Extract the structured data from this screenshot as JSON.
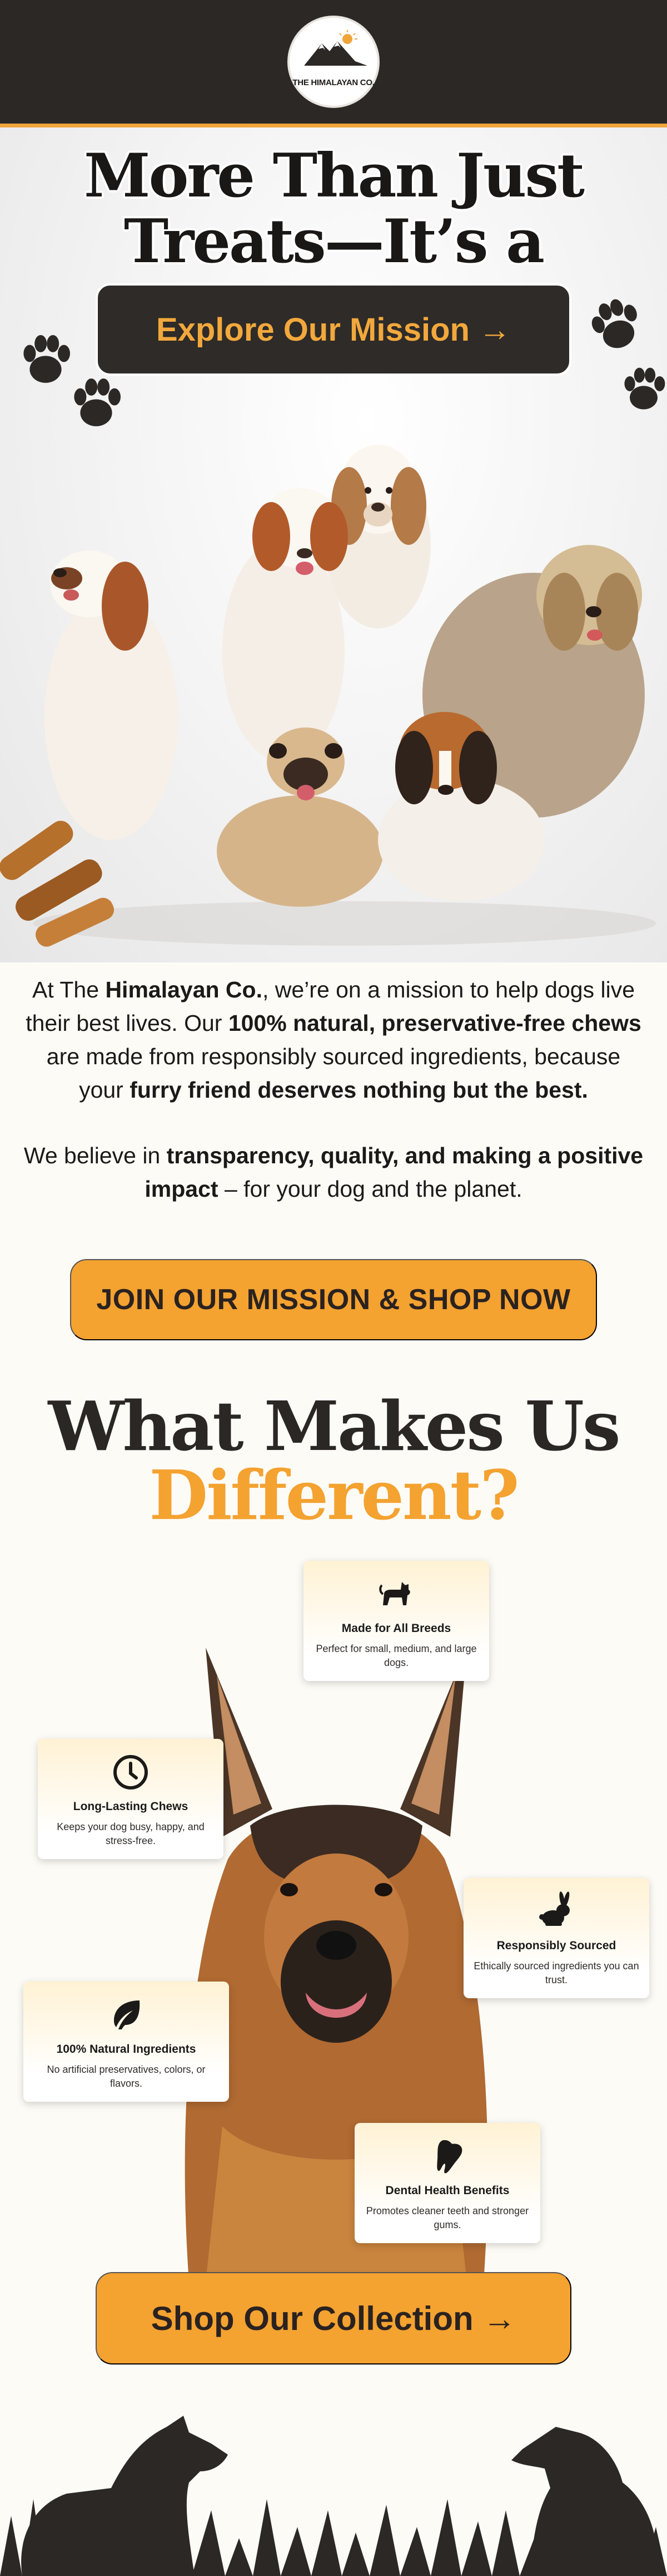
{
  "brand": {
    "logo_text": "THE HIMALAYAN CO.",
    "colors": {
      "dark": "#2b2826",
      "accent": "#f4a230",
      "cream": "#fdfbf6"
    }
  },
  "hero": {
    "title_line1": "More Than Just",
    "title_line2": "Treats—It’s a",
    "cta_label": "Explore Our Mission →",
    "icons": [
      "paw-icon",
      "treat-bones-icon"
    ]
  },
  "mission": {
    "p1": [
      {
        "t": "At The ",
        "b": false
      },
      {
        "t": "Himalayan Co.",
        "b": true
      },
      {
        "t": ", we’re on a mission to help dogs live their best lives. Our ",
        "b": false
      },
      {
        "t": "100% natural, preservative-free chews",
        "b": true
      },
      {
        "t": " are made from responsibly sourced ingredients, because your ",
        "b": false
      },
      {
        "t": "furry friend deserves nothing but the best.",
        "b": true
      }
    ],
    "p2": [
      {
        "t": "We believe in ",
        "b": false
      },
      {
        "t": "transparency, quality, and making a positive impact",
        "b": true
      },
      {
        "t": " – for your dog and the planet.",
        "b": false
      }
    ],
    "cta_label": "JOIN OUR MISSION & SHOP NOW"
  },
  "different": {
    "title_line1": "What Makes Us",
    "title_line2": "Different?",
    "cards": [
      {
        "icon": "dog-icon",
        "title": "Made for All Breeds",
        "desc": "Perfect for small, medium, and large dogs."
      },
      {
        "icon": "clock-icon",
        "title": "Long-Lasting Chews",
        "desc": "Keeps your dog busy, happy, and stress-free."
      },
      {
        "icon": "rabbit-icon",
        "title": "Responsibly Sourced",
        "desc": "Ethically sourced ingredients you can trust."
      },
      {
        "icon": "leaf-icon",
        "title": "100% Natural Ingredients",
        "desc": "No artificial preservatives, colors, or flavors."
      },
      {
        "icon": "tooth-icon",
        "title": "Dental Health Benefits",
        "desc": "Promotes cleaner teeth and stronger gums."
      }
    ],
    "cta_label": "Shop Our Collection →"
  }
}
